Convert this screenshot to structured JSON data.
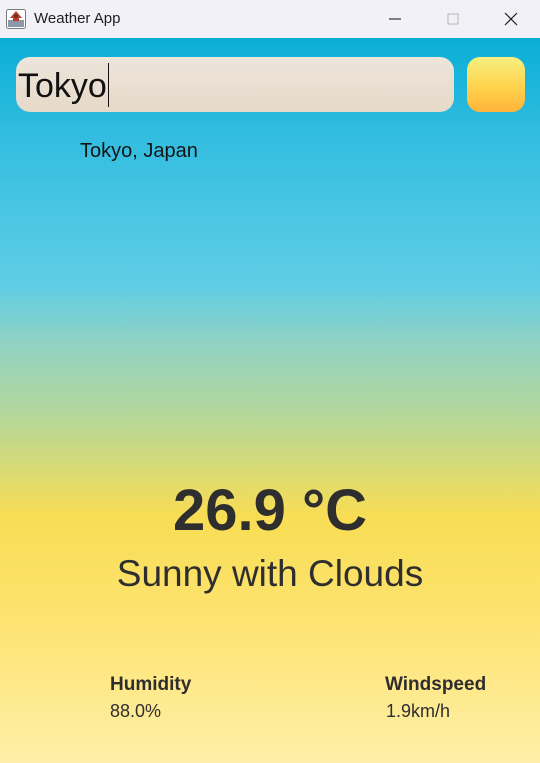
{
  "window": {
    "title": "Weather App",
    "icon": "weather-app-icon"
  },
  "search": {
    "value": "Tokyo",
    "button_icon": "search-button-blank"
  },
  "location": "Tokyo, Japan",
  "weather": {
    "temperature": "26.9 °C",
    "condition": "Sunny with Clouds"
  },
  "stats": {
    "humidity_label": "Humidity",
    "humidity_value": "88.0%",
    "wind_label": "Windspeed",
    "wind_value": "1.9km/h"
  },
  "colors": {
    "sky_top": "#0aaed6",
    "sky_mid": "#5fcde5",
    "sun": "#f8dd54",
    "text": "#2e2e2e",
    "search_button": "#ffc845"
  }
}
